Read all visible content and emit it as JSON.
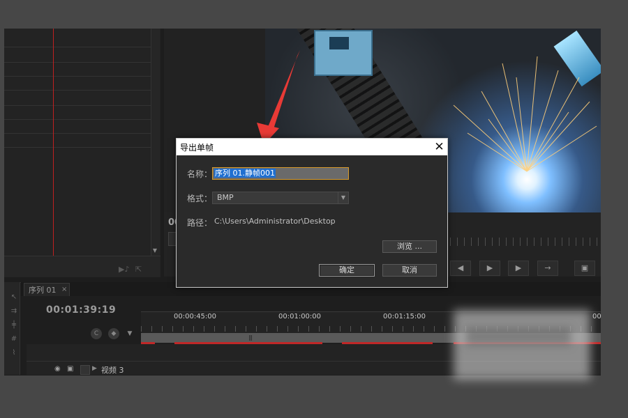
{
  "dialog": {
    "title": "导出单帧",
    "name_label": "名称：",
    "name_value": "序列 01.静帧001",
    "format_label": "格式：",
    "format_value": "BMP",
    "path_label": "路径：",
    "path_value": "C:\\Users\\Administrator\\Desktop",
    "browse_label": "浏览 ...",
    "ok_label": "确定",
    "cancel_label": "取消",
    "close_glyph": "✕"
  },
  "monitor": {
    "timecode_partial": "00"
  },
  "timeline": {
    "tab_label": "序列 01",
    "tab_close": "×",
    "timecode": "00:01:39:19",
    "ruler_labels": [
      "00:00:45:00",
      "00:01:00:00",
      "00:01:15:00",
      "00"
    ],
    "track_name": "视频 3"
  },
  "colors": {
    "accent_input_border": "#d79a2a",
    "selection_blue": "#1f6fd0",
    "annotation_arrow": "#e83a36",
    "playhead_red": "#c02020"
  },
  "icons": {
    "step_back": "◀",
    "play": "▶",
    "step_forward": "▶",
    "insert": "→",
    "export_frame": "▣"
  }
}
